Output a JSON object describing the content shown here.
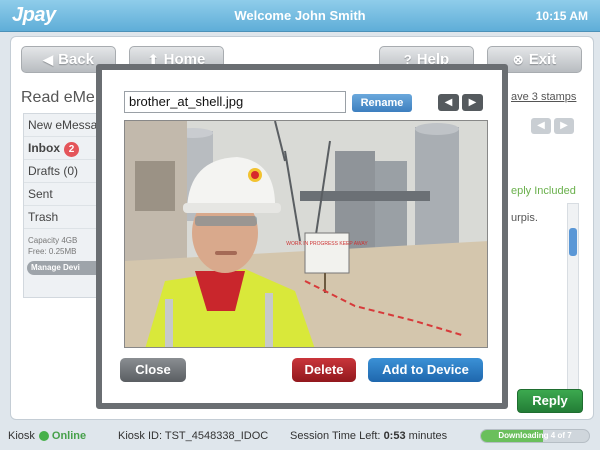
{
  "header": {
    "logo": "Jpay",
    "welcome": "Welcome John Smith",
    "time": "10:15 AM"
  },
  "nav": {
    "back": "Back",
    "home": "Home",
    "help": "Help",
    "exit": "Exit"
  },
  "page": {
    "title": "Read eMe",
    "stamps_link": "ave 3 stamps",
    "reply_included": "eply Included",
    "message_snippet": "urpis.",
    "reply_label": "Reply"
  },
  "sidebar": {
    "items": [
      {
        "label": "New eMessa"
      },
      {
        "label": "Inbox",
        "badge": "2"
      },
      {
        "label": "Drafts (0)"
      },
      {
        "label": "Sent"
      },
      {
        "label": "Trash"
      }
    ],
    "capacity": "Capacity 4GB",
    "free": "Free: 0.25MB",
    "manage": "Manage Devi"
  },
  "modal": {
    "filename": "brother_at_shell.jpg",
    "rename": "Rename",
    "close": "Close",
    "delete": "Delete",
    "add_to_device": "Add to Device",
    "sign_text": "WORK IN PROGRESS KEEP AWAY"
  },
  "footer": {
    "kiosk_label": "Kiosk",
    "status": "Online",
    "kiosk_id": "Kiosk ID: TST_4548338_IDOC",
    "session_label": "Session Time Left:",
    "session_value": "0:53",
    "session_unit": "minutes",
    "download_text": "Downloading 4 of 7",
    "download_progress": 0.57
  },
  "colors": {
    "header": "#6ab8e0",
    "online": "#46b04a",
    "reply": "#2e9442",
    "delete": "#b82a30",
    "add": "#2b7cc4"
  }
}
